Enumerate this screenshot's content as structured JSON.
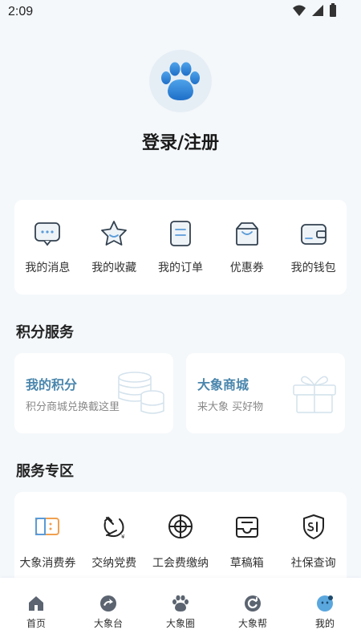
{
  "status_bar": {
    "time": "2:09"
  },
  "profile": {
    "login_label": "登录/注册"
  },
  "quick_links": [
    {
      "label": "我的消息",
      "icon": "message-icon"
    },
    {
      "label": "我的收藏",
      "icon": "star-icon"
    },
    {
      "label": "我的订单",
      "icon": "order-icon"
    },
    {
      "label": "优惠券",
      "icon": "coupon-icon"
    },
    {
      "label": "我的钱包",
      "icon": "wallet-icon"
    }
  ],
  "points_section": {
    "title": "积分服务",
    "cards": [
      {
        "title": "我的积分",
        "subtitle": "积分商城兑换截这里",
        "icon": "coins-icon"
      },
      {
        "title": "大象商城",
        "subtitle": "来大象  买好物",
        "icon": "gift-icon"
      }
    ]
  },
  "service_section": {
    "title": "服务专区",
    "items": [
      {
        "label": "大象消费券",
        "icon": "voucher-icon"
      },
      {
        "label": "交纳党费",
        "icon": "party-icon"
      },
      {
        "label": "工会费缴纳",
        "icon": "union-fee-icon"
      },
      {
        "label": "草稿箱",
        "icon": "drafts-icon"
      },
      {
        "label": "社保查询",
        "icon": "social-security-icon"
      }
    ]
  },
  "tab_bar": [
    {
      "label": "首页",
      "icon": "home-icon"
    },
    {
      "label": "大象台",
      "icon": "dxt-icon"
    },
    {
      "label": "大象圈",
      "icon": "paw-icon"
    },
    {
      "label": "大象帮",
      "icon": "help-icon"
    },
    {
      "label": "我的",
      "icon": "mine-icon",
      "active": true
    }
  ],
  "colors": {
    "accent": "#4a86ad",
    "brand_blue": "#2a7fd6",
    "background": "#f4f8fb"
  }
}
